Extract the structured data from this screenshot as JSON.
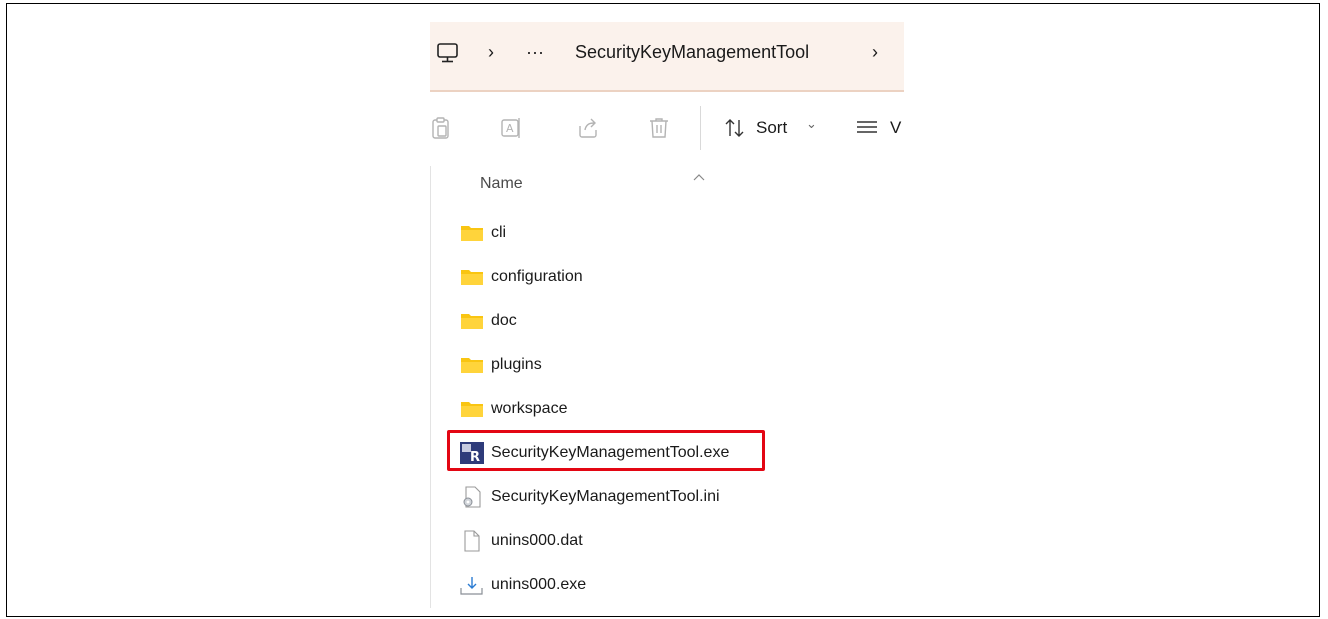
{
  "breadcrumb": {
    "computer_icon": "computer-icon",
    "separator": "›",
    "overflow": "···",
    "folder": "SecurityKeyManagementTool",
    "trailing_separator": "›"
  },
  "toolbar": {
    "icons": [
      "paste-icon",
      "rename-icon",
      "share-icon",
      "delete-icon"
    ],
    "sort_label": "Sort",
    "sort_chevron": "⌄",
    "view_label_partial": "V"
  },
  "list": {
    "column_header": "Name",
    "items": [
      {
        "name": "cli",
        "icon": "folder-icon"
      },
      {
        "name": "configuration",
        "icon": "folder-icon"
      },
      {
        "name": "doc",
        "icon": "folder-icon"
      },
      {
        "name": "plugins",
        "icon": "folder-icon"
      },
      {
        "name": "workspace",
        "icon": "folder-icon"
      },
      {
        "name": "SecurityKeyManagementTool.exe",
        "icon": "app-exe-icon",
        "highlighted": true
      },
      {
        "name": "SecurityKeyManagementTool.ini",
        "icon": "settings-file-icon"
      },
      {
        "name": "unins000.dat",
        "icon": "blank-file-icon"
      },
      {
        "name": "unins000.exe",
        "icon": "installer-icon"
      }
    ]
  },
  "colors": {
    "address_bg": "#fbf2ec",
    "folder": "#f9c512",
    "highlight_border": "#e30613"
  }
}
